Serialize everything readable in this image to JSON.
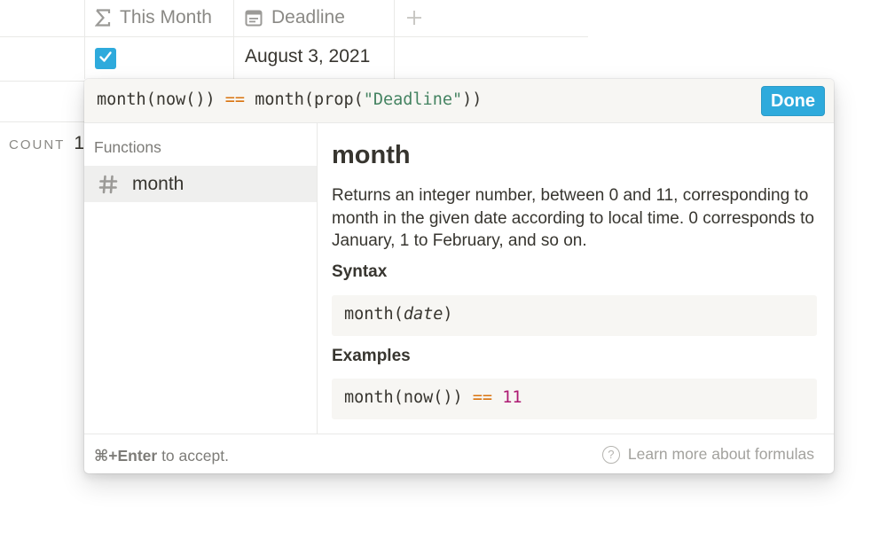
{
  "table": {
    "columns": [
      {
        "label": "This Month",
        "icon": "sigma-icon"
      },
      {
        "label": "Deadline",
        "icon": "calendar-icon"
      }
    ],
    "add_column_icon": "plus-icon",
    "row": {
      "this_month_checked": true,
      "deadline": "August 3, 2021"
    },
    "count": {
      "label": "COUNT",
      "value": "1"
    }
  },
  "popup": {
    "formula": {
      "prefix": "month(now()) ",
      "op": "==",
      "mid": " month(prop(",
      "str": "\"Deadline\"",
      "suffix": "))"
    },
    "done_label": "Done",
    "sidebar": {
      "section_title": "Functions",
      "items": [
        {
          "label": "month",
          "icon": "hash-icon",
          "selected": true
        }
      ]
    },
    "docs": {
      "title": "month",
      "description": "Returns an integer number, between 0 and 11, corresponding to month in the given date according to local time. 0 corresponds to January, 1 to February, and so on.",
      "syntax_heading": "Syntax",
      "syntax": {
        "fn": "month(",
        "arg": "date",
        "close": ")"
      },
      "examples_heading": "Examples",
      "example": {
        "prefix": "month(now()) ",
        "op": "==",
        "space": " ",
        "num": "11"
      }
    },
    "footer": {
      "shortcut": "⌘+Enter",
      "hint_rest": " to accept.",
      "learn_more": "Learn more about formulas",
      "help_icon": "question-circle-icon"
    }
  },
  "colors": {
    "accent": "#2eaadc",
    "operator": "#d9730d",
    "string": "#448361",
    "number": "#ad1a72"
  }
}
